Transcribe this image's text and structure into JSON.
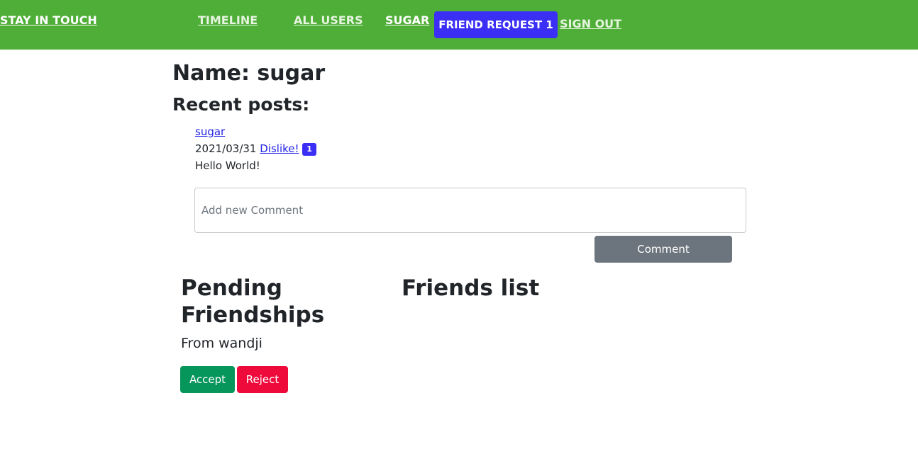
{
  "nav": {
    "brand": "STAY IN TOUCH",
    "links": [
      "TIMELINE",
      "ALL USERS",
      "SUGAR"
    ],
    "friend_request": "FRIEND REQUEST 1",
    "sign_out": "SIGN OUT"
  },
  "profile": {
    "name_heading": "Name: sugar",
    "recent_heading": "Recent posts:"
  },
  "post": {
    "author": "sugar",
    "date": "2021/03/31",
    "like_link": "Dislike!",
    "like_count": "1",
    "content": "Hello World!"
  },
  "comment": {
    "placeholder": "Add new Comment",
    "button": "Comment"
  },
  "friendships": {
    "pending_heading": "Pending Friendships",
    "from_text": "From wandji",
    "accept": "Accept",
    "reject": "Reject",
    "friends_heading": "Friends list"
  },
  "colors": {
    "navbar": "#4fae37",
    "primary": "#3b2ff6",
    "secondary": "#6c757d",
    "success": "#06955a",
    "danger": "#ef0a3c"
  }
}
